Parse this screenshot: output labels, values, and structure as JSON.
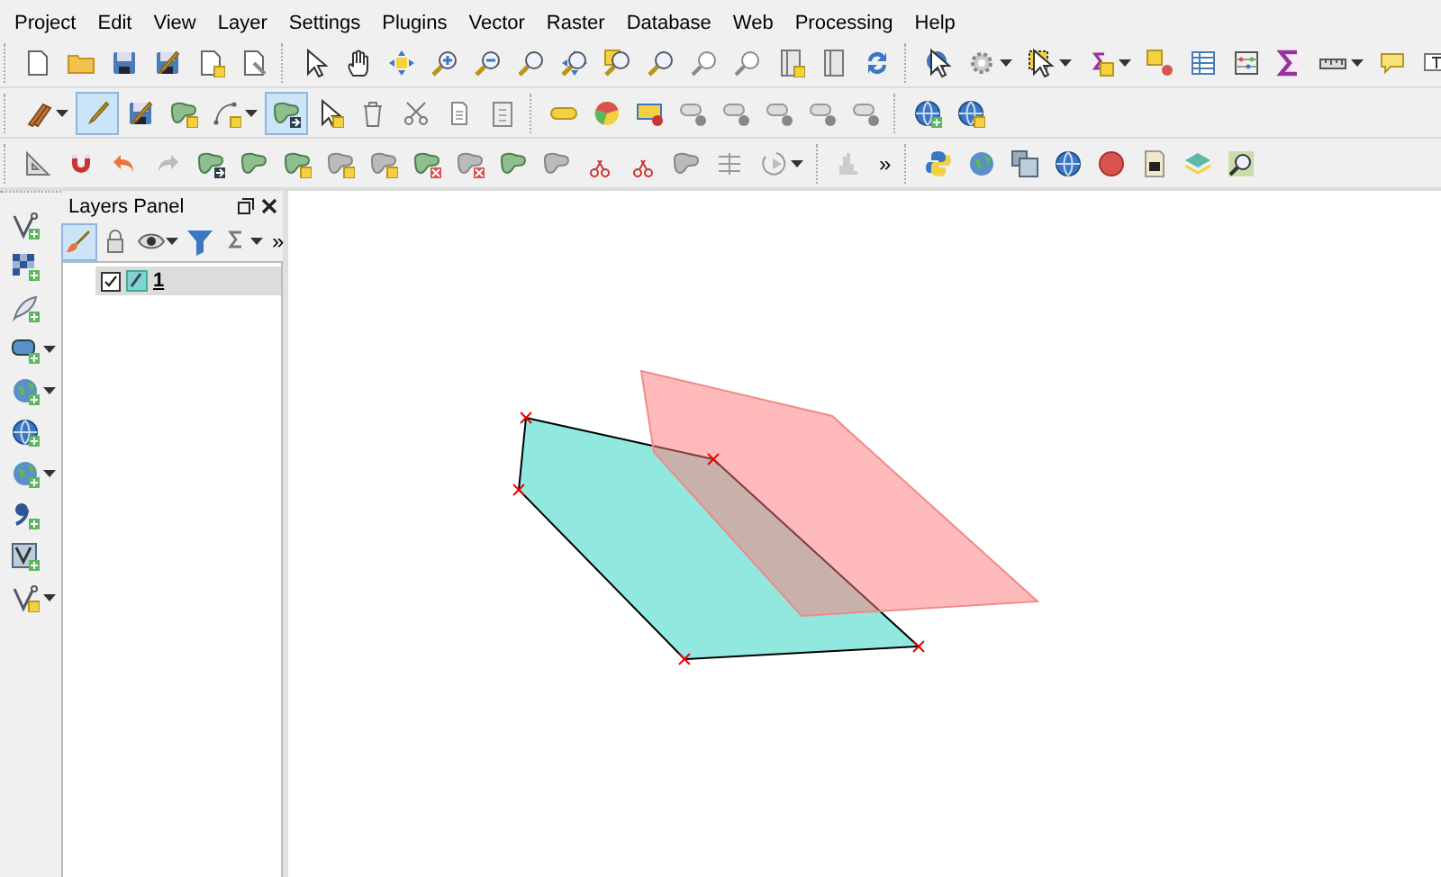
{
  "menu": [
    "Project",
    "Edit",
    "View",
    "Layer",
    "Settings",
    "Plugins",
    "Vector",
    "Raster",
    "Database",
    "Web",
    "Processing",
    "Help"
  ],
  "toolbars": [
    [
      {
        "buttons": [
          {
            "kind": "new-file",
            "on": false
          },
          {
            "kind": "open-folder",
            "on": false
          },
          {
            "kind": "save",
            "on": false
          },
          {
            "kind": "save-as",
            "on": false
          },
          {
            "kind": "new-layout",
            "on": false
          },
          {
            "kind": "layout-manager",
            "on": false
          }
        ]
      },
      {
        "buttons": [
          {
            "kind": "pointer",
            "on": false
          },
          {
            "kind": "pan-hand",
            "on": false
          },
          {
            "kind": "pan-to-selection",
            "on": false
          },
          {
            "kind": "zoom-in",
            "on": false
          },
          {
            "kind": "zoom-out",
            "on": false
          },
          {
            "kind": "zoom-native",
            "on": false
          },
          {
            "kind": "zoom-full",
            "on": false
          },
          {
            "kind": "zoom-selection",
            "on": false
          },
          {
            "kind": "zoom-layer",
            "on": false
          },
          {
            "kind": "zoom-last",
            "on": false
          },
          {
            "kind": "zoom-next",
            "on": false
          },
          {
            "kind": "new-bookmark",
            "on": false
          },
          {
            "kind": "bookmarks",
            "on": false
          },
          {
            "kind": "refresh",
            "on": false
          }
        ]
      },
      {
        "buttons": [
          {
            "kind": "identify",
            "on": false
          },
          {
            "kind": "gear",
            "on": false,
            "menu": true
          },
          {
            "kind": "select",
            "on": false,
            "menu": true
          },
          {
            "kind": "expression-select",
            "on": false,
            "menu": true
          },
          {
            "kind": "deselect",
            "on": false
          },
          {
            "kind": "table",
            "on": false
          },
          {
            "kind": "statistics",
            "on": false
          },
          {
            "kind": "sigma",
            "on": false
          },
          {
            "kind": "ruler",
            "on": false,
            "menu": true
          },
          {
            "kind": "comment",
            "on": false
          },
          {
            "kind": "text-note",
            "on": false
          }
        ]
      }
    ],
    [
      {
        "buttons": [
          {
            "kind": "pencils",
            "on": false,
            "menu": true
          },
          {
            "kind": "pencil",
            "on": true
          },
          {
            "kind": "save-edits",
            "on": false
          },
          {
            "kind": "add-polygon",
            "on": false
          },
          {
            "kind": "add-curve",
            "on": false,
            "menu": true
          },
          {
            "kind": "node-tool",
            "on": true
          },
          {
            "kind": "modify-attributes",
            "on": false
          },
          {
            "kind": "trash",
            "on": false
          },
          {
            "kind": "scissors",
            "on": false
          },
          {
            "kind": "copy",
            "on": false
          },
          {
            "kind": "paste",
            "on": false
          }
        ]
      },
      {
        "buttons": [
          {
            "kind": "label",
            "on": false
          },
          {
            "kind": "pie-chart",
            "on": false
          },
          {
            "kind": "label-pin",
            "on": false
          },
          {
            "kind": "label-show",
            "on": false
          },
          {
            "kind": "label-eye",
            "on": false
          },
          {
            "kind": "label-move",
            "on": false
          },
          {
            "kind": "label-rotate",
            "on": false
          },
          {
            "kind": "label-edit",
            "on": false
          }
        ]
      },
      {
        "buttons": [
          {
            "kind": "globe-plus",
            "on": false
          },
          {
            "kind": "globe-search",
            "on": false
          }
        ]
      }
    ],
    [
      {
        "buttons": [
          {
            "kind": "set-square",
            "on": false
          },
          {
            "kind": "magnet",
            "on": false
          },
          {
            "kind": "undo",
            "on": false
          },
          {
            "kind": "redo",
            "on": false
          },
          {
            "kind": "rotate-feature",
            "on": false
          },
          {
            "kind": "simplify",
            "on": false
          },
          {
            "kind": "add-ring",
            "on": false
          },
          {
            "kind": "add-part",
            "on": false
          },
          {
            "kind": "fill-ring",
            "on": false
          },
          {
            "kind": "delete-ring",
            "on": false
          },
          {
            "kind": "delete-part",
            "on": false
          },
          {
            "kind": "reshape",
            "on": false
          },
          {
            "kind": "offset-curve",
            "on": false
          },
          {
            "kind": "split-features",
            "on": false
          },
          {
            "kind": "split-parts",
            "on": false
          },
          {
            "kind": "merge",
            "on": false
          },
          {
            "kind": "align",
            "on": false
          },
          {
            "kind": "rotate-point",
            "on": false,
            "menu": true
          }
        ]
      },
      {
        "buttons": [
          {
            "kind": "histogram",
            "on": false
          }
        ],
        "more": "»"
      },
      {
        "buttons": [
          {
            "kind": "python",
            "on": false
          },
          {
            "kind": "globe",
            "on": false
          },
          {
            "kind": "layers-stack",
            "on": false
          },
          {
            "kind": "earth",
            "on": false
          },
          {
            "kind": "app-badge",
            "on": false
          },
          {
            "kind": "camera",
            "on": false
          },
          {
            "kind": "layers",
            "on": false
          },
          {
            "kind": "map-zoom",
            "on": false
          }
        ]
      }
    ]
  ],
  "side_tools": [
    {
      "kind": "add-vector",
      "on": false
    },
    {
      "kind": "add-raster",
      "on": false
    },
    {
      "kind": "add-feather",
      "on": false
    },
    {
      "kind": "add-rect",
      "on": false,
      "menu": true
    },
    {
      "kind": "add-wms",
      "on": false,
      "menu": true
    },
    {
      "kind": "add-wcs",
      "on": false
    },
    {
      "kind": "add-wfs",
      "on": false,
      "menu": true
    },
    {
      "kind": "add-comma",
      "on": false
    },
    {
      "kind": "add-virtual",
      "on": false
    },
    {
      "kind": "add-vertex",
      "on": false,
      "menu": true
    }
  ],
  "layers_panel": {
    "title": "Layers Panel",
    "tools": [
      {
        "kind": "brush",
        "on": true
      },
      {
        "kind": "lock",
        "on": false
      },
      {
        "kind": "eye",
        "on": false,
        "menu": true
      },
      {
        "kind": "filter",
        "on": false
      },
      {
        "kind": "expression-filter",
        "on": false,
        "menu": true
      }
    ],
    "more": "»",
    "layers": [
      {
        "name": "1",
        "checked": true,
        "selected": true
      }
    ]
  }
}
